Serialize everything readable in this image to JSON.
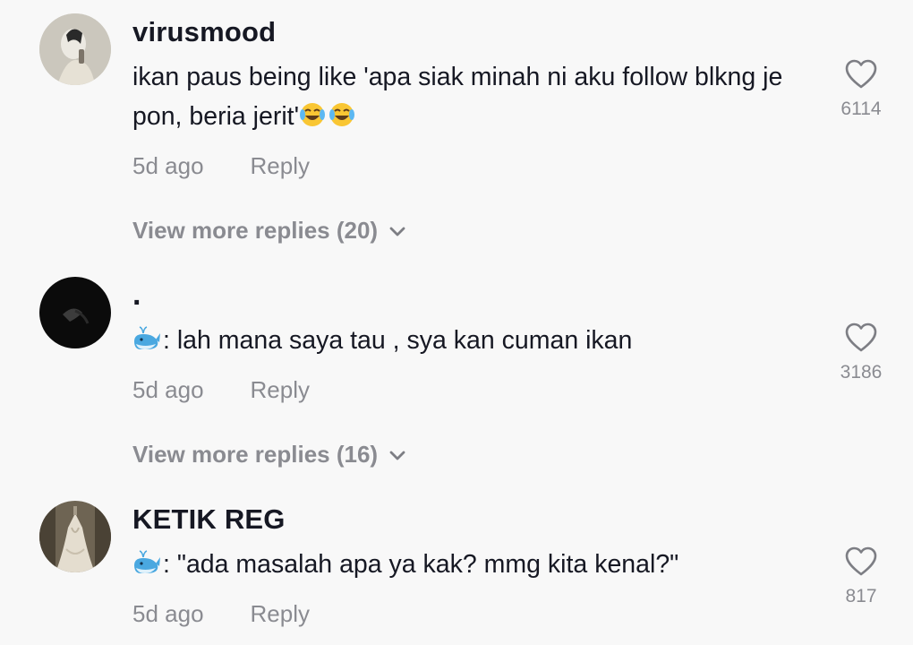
{
  "comments": [
    {
      "username": "virusmood",
      "text": "ikan paus being like 'apa siak minah ni aku follow blkng je pon, beria jerit'",
      "emoji": "face-with-tears-of-joy-emoji",
      "time": "5d ago",
      "reply_label": "Reply",
      "likes": "6114",
      "view_more": "View more replies (20)"
    },
    {
      "username": ".",
      "text": ": lah mana saya tau , sya kan cuman ikan",
      "emoji": "whale-emoji",
      "time": "5d ago",
      "reply_label": "Reply",
      "likes": "3186",
      "view_more": "View more replies (16)"
    },
    {
      "username": "KETIK REG",
      "text": ": \"ada masalah apa ya kak? mmg kita kenal?\"",
      "emoji": "whale-emoji",
      "time": "5d ago",
      "reply_label": "Reply",
      "likes": "817"
    }
  ],
  "icons": {
    "heart": "heart-outline-icon",
    "chevron": "chevron-down-icon"
  },
  "colors": {
    "background": "#f8f8f8",
    "text": "#161823",
    "muted": "#8a8b91"
  }
}
